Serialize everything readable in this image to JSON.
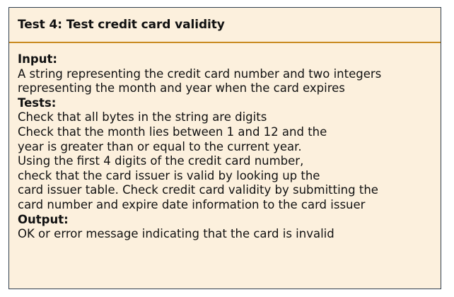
{
  "title": "Test 4: Test credit card validity",
  "sections": [
    {
      "label": "Input:",
      "lines": [
        "A string representing the credit card number and two integers",
        "representing the month and year when the card expires"
      ]
    },
    {
      "label": "Tests:",
      "lines": [
        "Check that all bytes in the string are digits",
        "Check that the month lies between 1 and 12 and the",
        "year is greater than or equal to the current year.",
        "Using the first 4 digits of the credit card number,",
        "check that the card issuer is valid by looking up the",
        "card issuer table. Check credit card validity by submitting the",
        "card number and expire date information to the card issuer"
      ]
    },
    {
      "label": "Output:",
      "lines": [
        "OK or error message indicating that the card is invalid"
      ]
    }
  ]
}
